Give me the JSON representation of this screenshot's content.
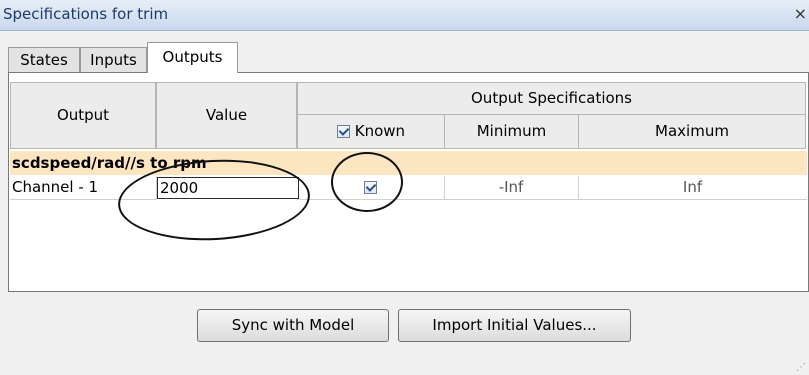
{
  "window": {
    "title": "Specifications for trim",
    "close_glyph": "×"
  },
  "tabs": [
    {
      "label": "States",
      "active": false
    },
    {
      "label": "Inputs",
      "active": false
    },
    {
      "label": "Outputs",
      "active": true
    }
  ],
  "table": {
    "headers": {
      "output": "Output",
      "value": "Value",
      "group": "Output Specifications",
      "known": "Known",
      "minimum": "Minimum",
      "maximum": "Maximum"
    },
    "known_header_checked": true,
    "group_row_label": "scdspeed/rad//s to rpm",
    "rows": [
      {
        "output": "Channel - 1",
        "value": "2000",
        "known": true,
        "minimum": "-Inf",
        "maximum": "Inf"
      }
    ]
  },
  "buttons": {
    "sync": "Sync with Model",
    "import": "Import Initial Values..."
  },
  "colors": {
    "group_row_bg": "#fce6c2",
    "titlebar_text": "#1e3a66"
  }
}
